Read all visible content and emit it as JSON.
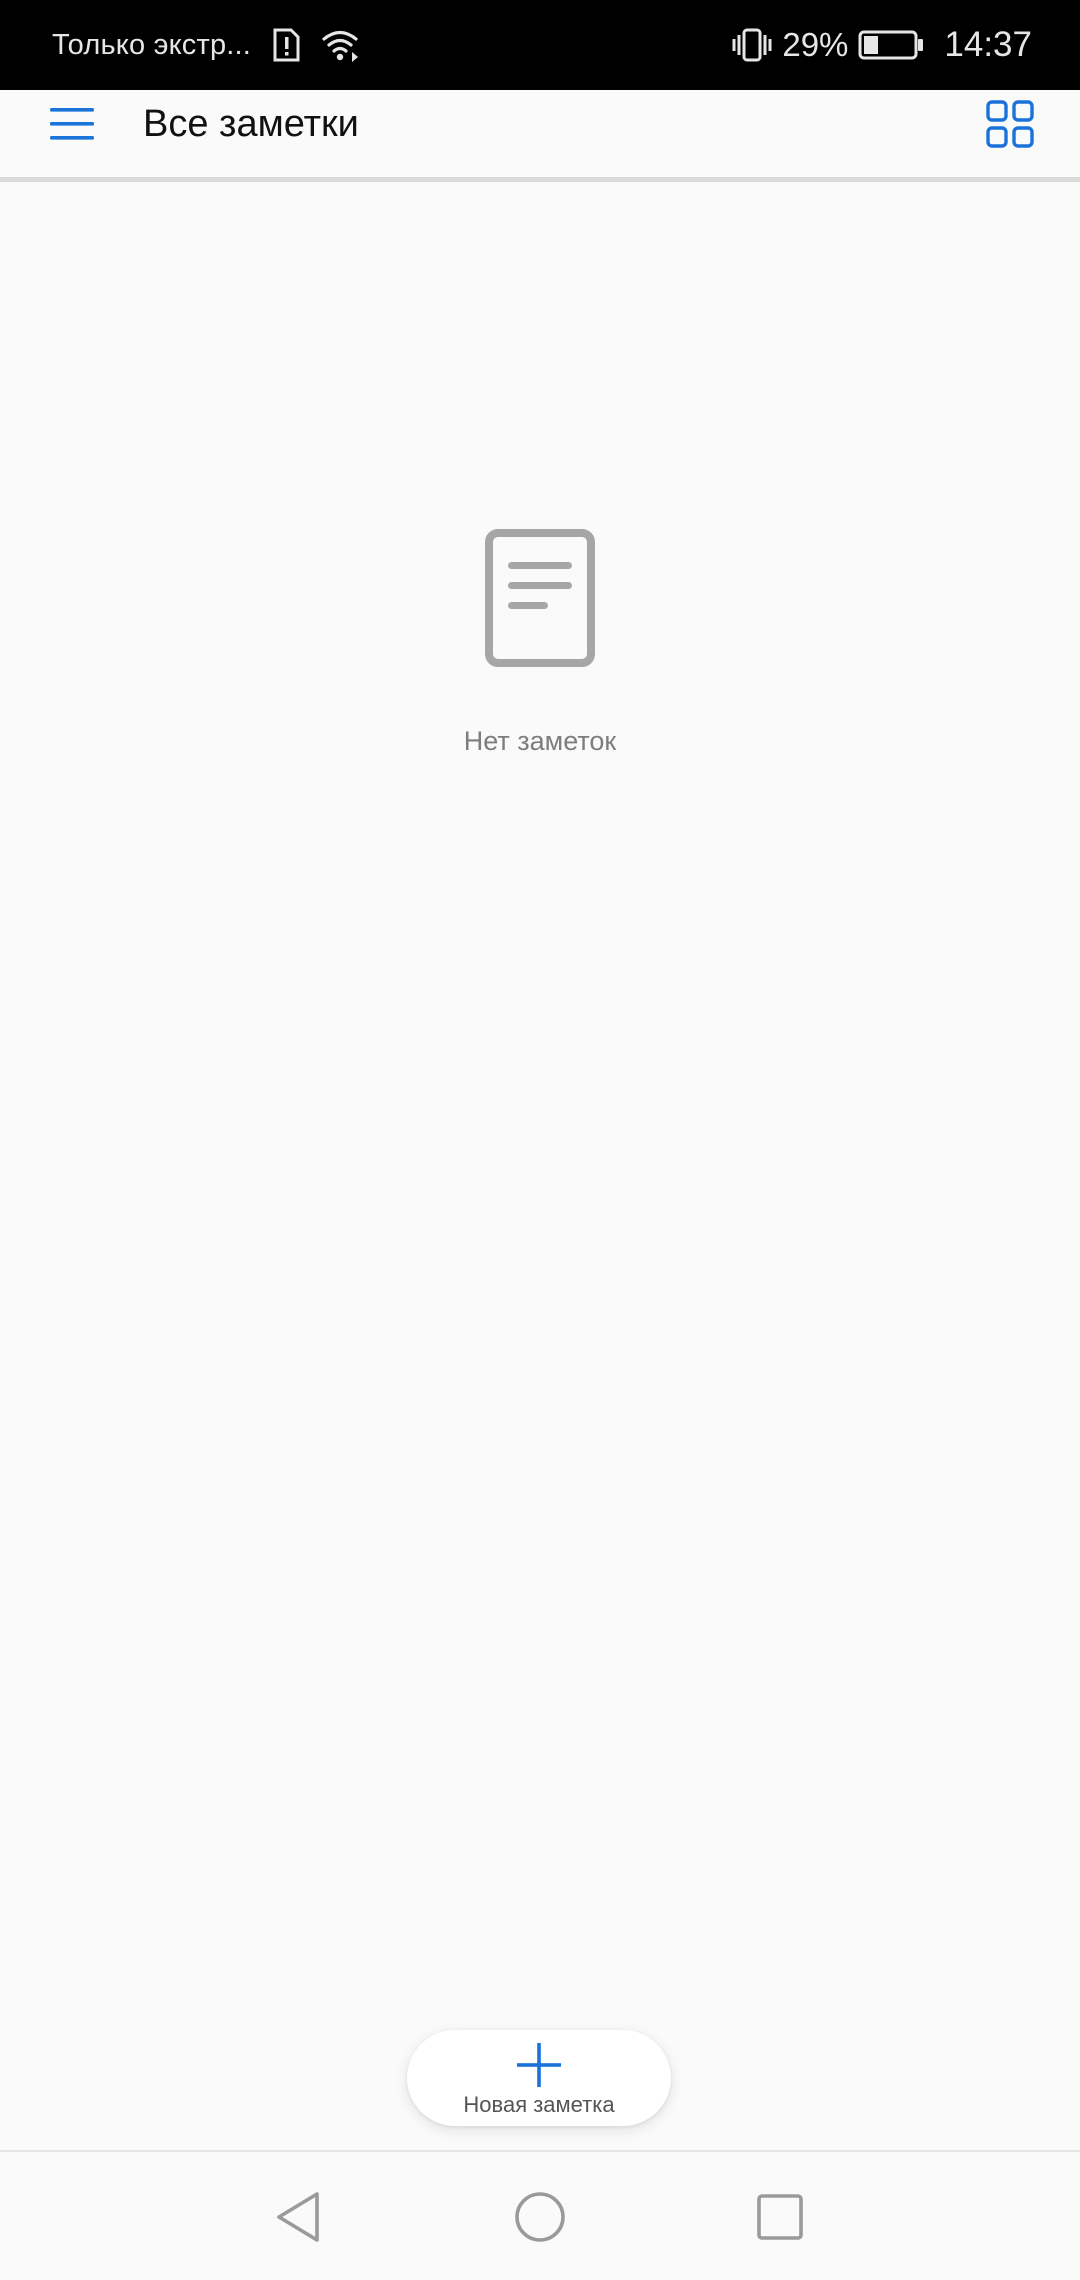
{
  "status_bar": {
    "carrier_text": "Только экстр...",
    "battery_percent": "29%",
    "time": "14:37",
    "battery_level": 0.29,
    "icons": [
      "sim-alert-icon",
      "wifi-icon",
      "vibrate-icon",
      "battery-icon"
    ]
  },
  "app_bar": {
    "title": "Все заметки",
    "icons": [
      "menu-icon",
      "grid-view-icon"
    ]
  },
  "empty_state": {
    "icon": "note-document-icon",
    "message": "Нет заметок"
  },
  "fab": {
    "icon": "plus-icon",
    "label": "Новая заметка"
  },
  "nav_bar": {
    "icons": [
      "back-icon",
      "home-icon",
      "recents-icon"
    ]
  },
  "colors": {
    "accent": "#1a73d9",
    "background": "#fafafa",
    "status_bar": "#000000",
    "muted_icon": "#a6a6a6"
  }
}
